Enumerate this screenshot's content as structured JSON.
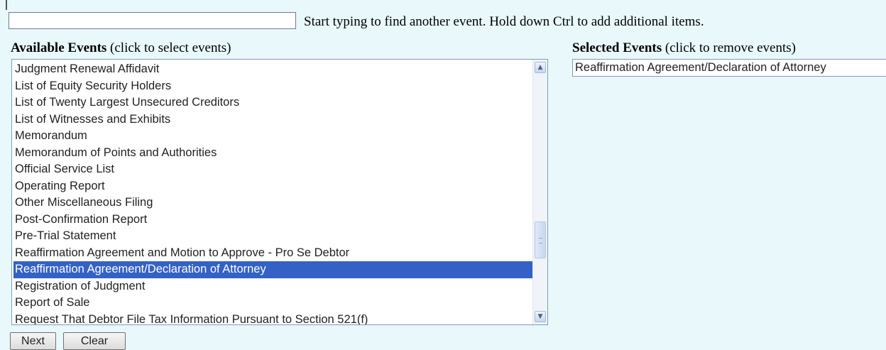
{
  "search": {
    "value": "",
    "hint": "Start typing to find another event. Hold down Ctrl to add additional items."
  },
  "available": {
    "heading_bold": "Available Events",
    "heading_note": " (click to select events)",
    "items": [
      "Judgment Renewal Affidavit",
      "List of Equity Security Holders",
      "List of Twenty Largest Unsecured Creditors",
      "List of Witnesses and Exhibits",
      "Memorandum",
      "Memorandum of Points and Authorities",
      "Official Service List",
      "Operating Report",
      "Other Miscellaneous Filing",
      "Post-Confirmation Report",
      "Pre-Trial Statement",
      "Reaffirmation Agreement and Motion to Approve - Pro Se Debtor",
      "Reaffirmation Agreement/Declaration of Attorney",
      "Registration of Judgment",
      "Report of Sale",
      "Request That Debtor File Tax Information Pursuant to Section 521(f)"
    ],
    "selected_index": 12
  },
  "selected": {
    "heading_bold": "Selected Events",
    "heading_note": " (click to remove events)",
    "items": [
      "Reaffirmation Agreement/Declaration of Attorney"
    ]
  },
  "buttons": {
    "next": "Next",
    "clear": "Clear"
  },
  "colors": {
    "background": "#e8f8fb",
    "highlight": "#3361c6"
  }
}
